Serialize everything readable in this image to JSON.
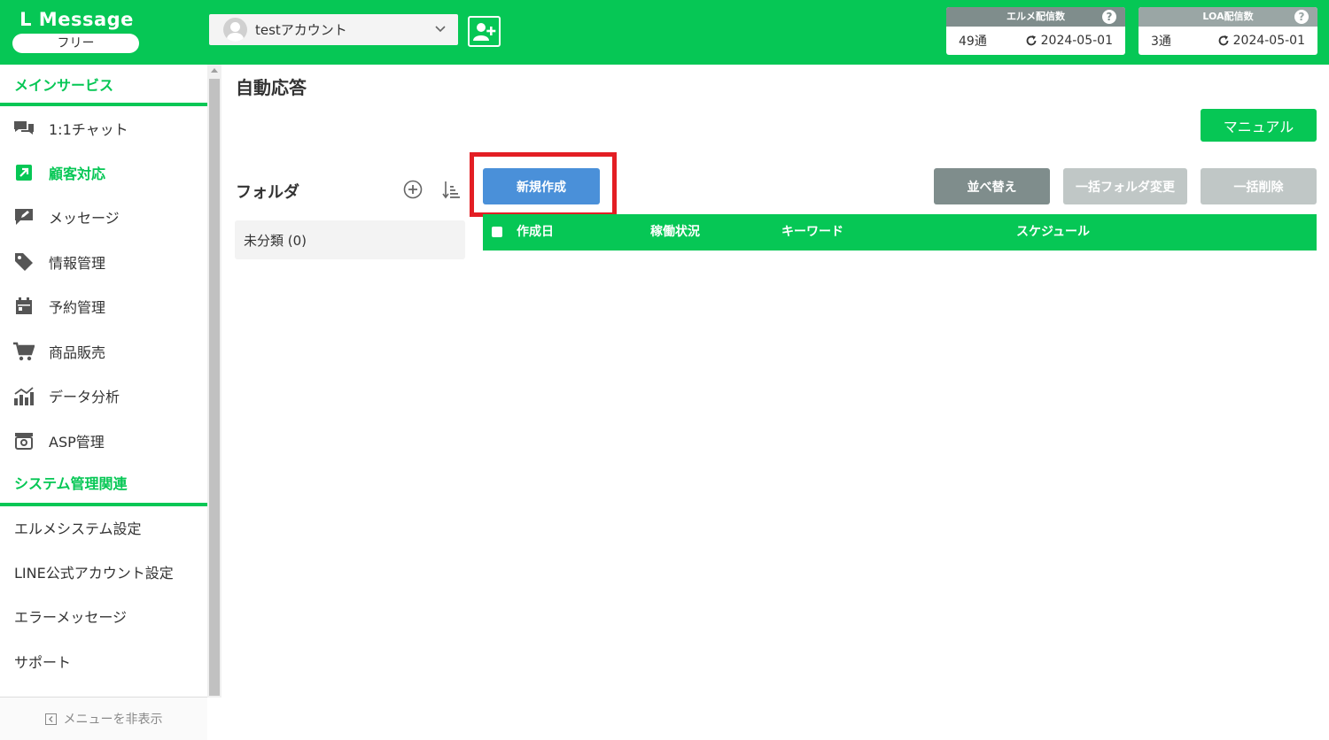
{
  "header": {
    "logo_title": "L Message",
    "logo_plan": "フリー",
    "account_name": "testアカウント",
    "elme_stats": {
      "title": "エルメ配信数",
      "help": "?",
      "count": "49通",
      "date": "2024-05-01"
    },
    "loa_stats": {
      "title": "LOA配信数",
      "help": "?",
      "count": "3通",
      "date": "2024-05-01"
    }
  },
  "sidebar": {
    "main_section": "メインサービス",
    "main_items": [
      {
        "label": "1:1チャット",
        "icon": "chat-icon"
      },
      {
        "label": "顧客対応",
        "icon": "arrow-box-icon"
      },
      {
        "label": "メッセージ",
        "icon": "message-edit-icon"
      },
      {
        "label": "情報管理",
        "icon": "tag-icon"
      },
      {
        "label": "予約管理",
        "icon": "calendar-icon"
      },
      {
        "label": "商品販売",
        "icon": "cart-icon"
      },
      {
        "label": "データ分析",
        "icon": "chart-icon"
      },
      {
        "label": "ASP管理",
        "icon": "asp-icon"
      }
    ],
    "system_section": "システム管理関連",
    "system_items": [
      {
        "label": "エルメシステム設定"
      },
      {
        "label": "LINE公式アカウント設定"
      },
      {
        "label": "エラーメッセージ"
      },
      {
        "label": "サポート"
      }
    ],
    "hide_menu": "メニューを非表示"
  },
  "main": {
    "page_title": "自動応答",
    "manual_button": "マニュアル",
    "folder_title": "フォルダ",
    "folder_item": "未分類 (0)",
    "new_button": "新規作成",
    "sort_button": "並べ替え",
    "folder_change_button": "一括フォルダ変更",
    "bulk_delete_button": "一括削除",
    "table_columns": [
      "作成日",
      "稼働状況",
      "キーワード",
      "スケジュール"
    ]
  },
  "colors": {
    "brand": "#06c755",
    "primary_button": "#4a90d9",
    "highlight": "#e31e24",
    "gray_button": "#7f8d8c",
    "disabled_button": "#c0c7c6"
  }
}
